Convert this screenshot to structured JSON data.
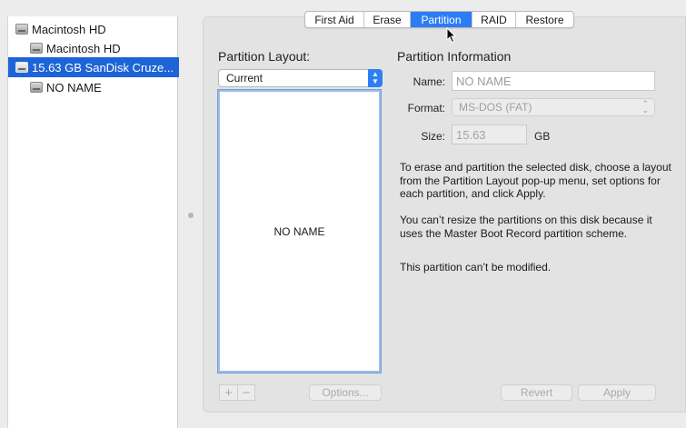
{
  "sidebar": {
    "items": [
      {
        "label": "Macintosh HD",
        "level": 0,
        "selected": false
      },
      {
        "label": "Macintosh HD",
        "level": 1,
        "selected": false
      },
      {
        "label": "15.63 GB SanDisk Cruze...",
        "level": 0,
        "selected": true
      },
      {
        "label": "NO NAME",
        "level": 1,
        "selected": false
      }
    ]
  },
  "tabs": [
    {
      "label": "First Aid",
      "active": false
    },
    {
      "label": "Erase",
      "active": false
    },
    {
      "label": "Partition",
      "active": true
    },
    {
      "label": "RAID",
      "active": false
    },
    {
      "label": "Restore",
      "active": false
    }
  ],
  "layout": {
    "title": "Partition Layout:",
    "popup_value": "Current",
    "partition_name": "NO NAME",
    "add_label": "+",
    "remove_label": "−",
    "options_label": "Options..."
  },
  "info": {
    "title": "Partition Information",
    "name_label": "Name:",
    "name_placeholder": "NO NAME",
    "format_label": "Format:",
    "format_value": "MS-DOS (FAT)",
    "size_label": "Size:",
    "size_value": "15.63",
    "size_unit": "GB",
    "paragraph1": "To erase and partition the selected disk, choose a layout from the Partition Layout pop-up menu, set options for each partition, and click Apply.",
    "paragraph2": "You can’t resize the partitions on this disk because it uses the Master Boot Record partition scheme.",
    "paragraph3": "This partition can’t be modified."
  },
  "footer": {
    "revert_label": "Revert",
    "apply_label": "Apply"
  },
  "colors": {
    "accent": "#2c7cf4",
    "selection": "#1d64d8"
  }
}
